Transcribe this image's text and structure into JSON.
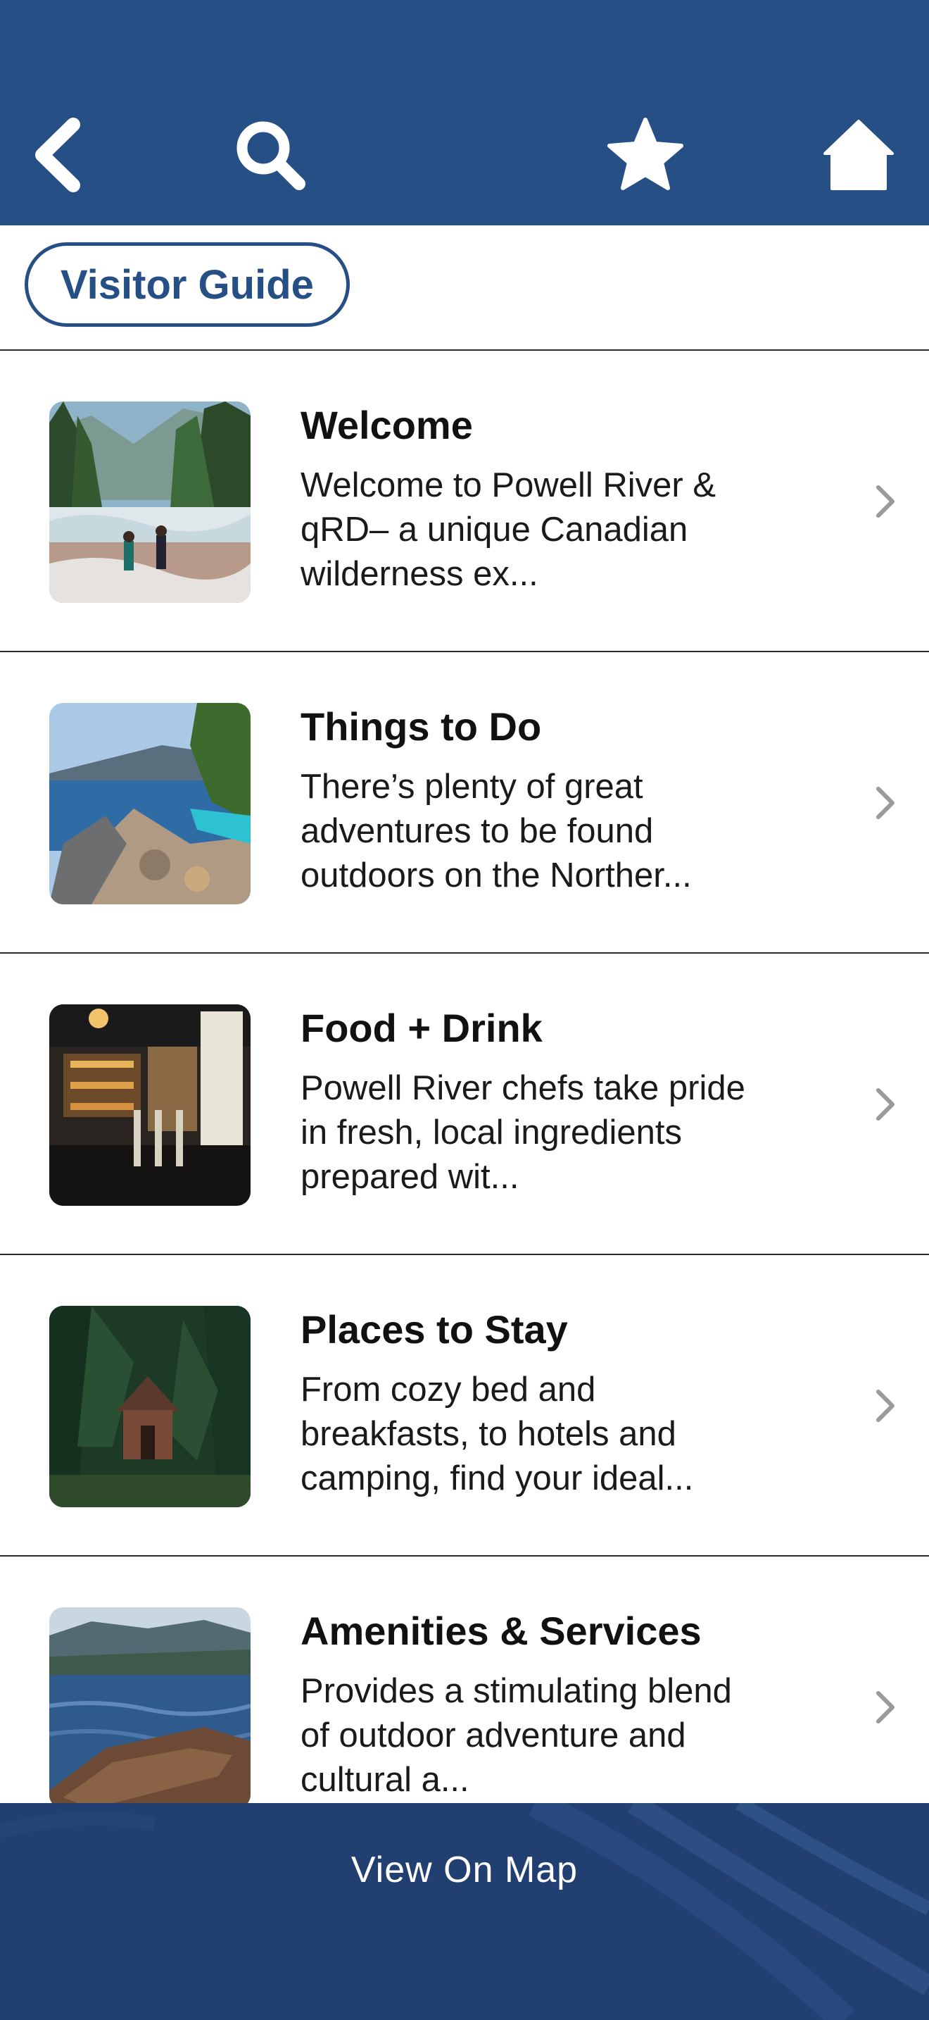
{
  "colors": {
    "brand": "#254f85",
    "bottom_bar": "#223f72",
    "chevron": "#9a9a9a"
  },
  "nav": {
    "back_icon": "chevron-left-icon",
    "search_icon": "search-icon",
    "favorite_icon": "star-icon",
    "home_icon": "home-icon"
  },
  "section": {
    "chip_label": "Visitor Guide"
  },
  "items": [
    {
      "title": "Welcome",
      "description": "Welcome to Powell River & qRD– a unique Canadian wilderness ex...",
      "image": "river-hikers-photo"
    },
    {
      "title": "Things to Do",
      "description": "There’s plenty of great adventures to be found outdoors on the Norther...",
      "image": "lake-kayak-photo"
    },
    {
      "title": "Food + Drink",
      "description": "Powell River chefs take pride in fresh, local ingredients prepared wit...",
      "image": "bar-taps-photo"
    },
    {
      "title": "Places to Stay",
      "description": "From cozy bed and breakfasts, to hotels and camping, find your ideal...",
      "image": "forest-cabin-photo"
    },
    {
      "title": "Amenities & Services",
      "description": "Provides a stimulating blend of outdoor adventure and cultural a...",
      "image": "lake-driftwood-photo"
    }
  ],
  "footer": {
    "map_button_label": "View On Map"
  }
}
